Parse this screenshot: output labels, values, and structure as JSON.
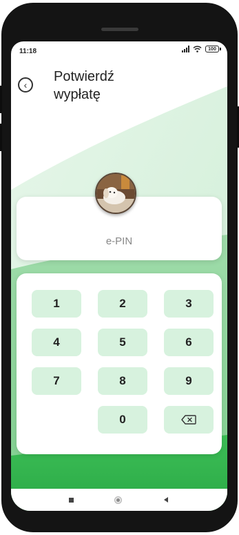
{
  "status_bar": {
    "time": "11:18",
    "battery": "100",
    "icons": [
      "signal-icon",
      "wifi-icon",
      "battery-icon"
    ]
  },
  "header": {
    "back_icon": "back-arrow-icon",
    "title_line1": "Potwierdź",
    "title_line2": "wypłatę"
  },
  "pin": {
    "label": "e-PIN",
    "avatar": "dog-avatar"
  },
  "keypad": {
    "keys": [
      "1",
      "2",
      "3",
      "4",
      "5",
      "6",
      "7",
      "8",
      "9",
      "",
      "0",
      "⌫"
    ],
    "delete_icon": "backspace-icon"
  },
  "nav_bar": {
    "icons": [
      "recent-apps-icon",
      "home-icon",
      "back-icon"
    ]
  },
  "colors": {
    "accent_green": "#2db34a",
    "light_green": "#d7f2de",
    "background_green": "#a8dfb2"
  }
}
